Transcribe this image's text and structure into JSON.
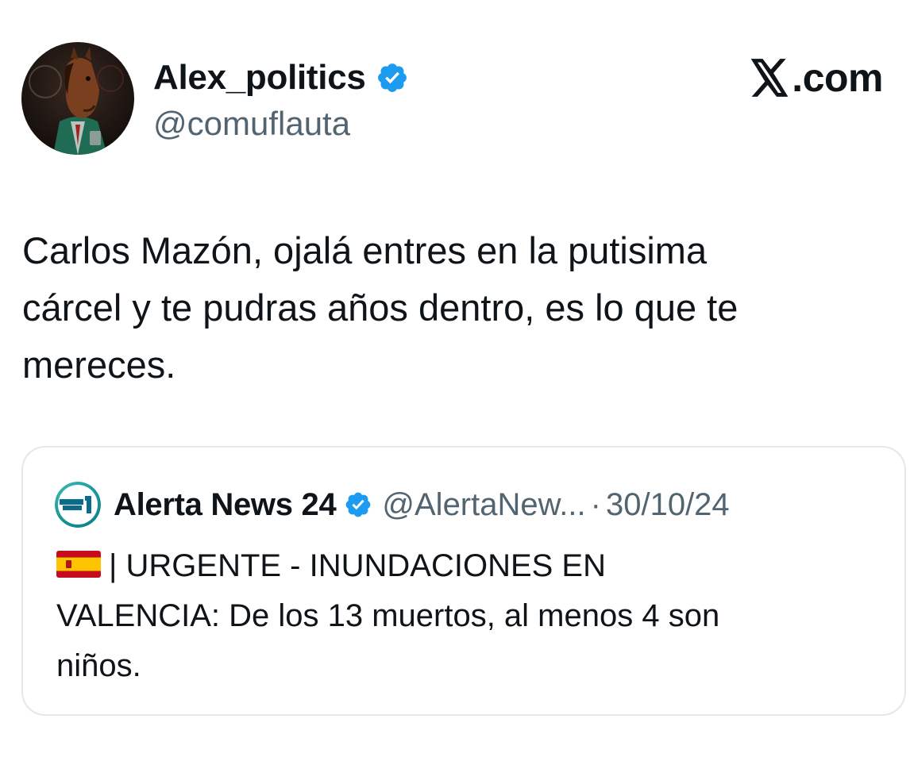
{
  "author": {
    "display_name": "Alex_politics",
    "handle": "@comuflauta",
    "verified": true,
    "avatar_icon": "horse-head-portrait-avatar"
  },
  "brand": {
    "label": ".com",
    "icon": "x-logo-icon"
  },
  "tweet": {
    "text": "Carlos Mazón, ojalá entres en la putisima\ncárcel y te pudras años dentro, es lo que te\nmereces."
  },
  "quoted_tweet": {
    "display_name": "Alerta News 24",
    "handle": "@AlertaNew...",
    "separator": "·",
    "date": "30/10/24",
    "verified": true,
    "avatar_icon": "alerta-news-24-logo",
    "flag_icon": "spain-flag-icon",
    "text": "| URGENTE - INUNDACIONES EN\nVALENCIA: De los 13 muertos, al menos 4 son\nniños."
  },
  "colors": {
    "verified_blue": "#1d9bf0",
    "text_primary": "#0f1419",
    "text_secondary": "#536471",
    "card_border": "#e4e8eb"
  }
}
